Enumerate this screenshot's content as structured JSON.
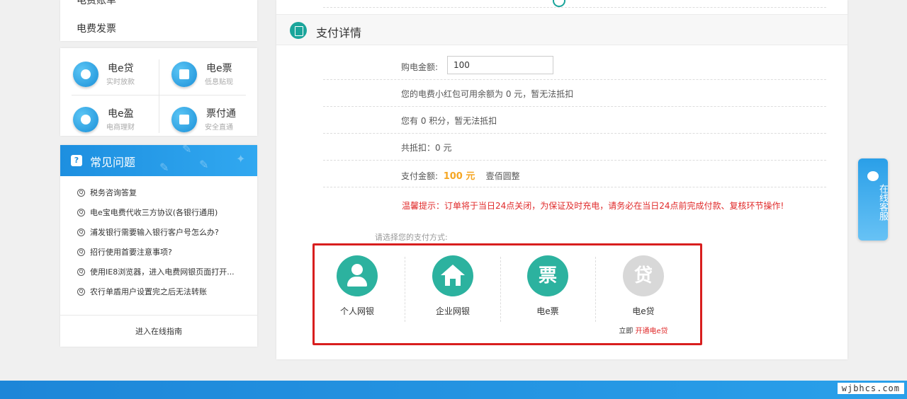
{
  "sidebar": {
    "menu_cut": "电费账单",
    "menu_invoice": "电费发票",
    "services": [
      {
        "name": "电e贷",
        "sub": "实时放款"
      },
      {
        "name": "电e票",
        "sub": "低息贴现"
      },
      {
        "name": "电e盈",
        "sub": "电商理财"
      },
      {
        "name": "票付通",
        "sub": "安全直通"
      }
    ],
    "faq": {
      "title": "常见问题",
      "items": [
        "税务咨询答复",
        "电e宝电费代收三方协议(各银行通用)",
        "浦发银行需要输入银行客户号怎么办?",
        "招行使用首要注意事项?",
        "使用IE8浏览器，进入电费网银页面打开...",
        "农行单盾用户设置完之后无法转账"
      ],
      "footer_link": "进入在线指南"
    }
  },
  "payment": {
    "title": "支付详情",
    "amount_label": "购电金额:",
    "amount_value": "100",
    "redpacket_text": "您的电费小红包可用余额为 0 元，暂无法抵扣",
    "points_text": "您有 0 积分，暂无法抵扣",
    "deduct_text": "共抵扣：0 元",
    "pay_label": "支付金额:",
    "pay_amount": "100 元",
    "pay_words": "壹佰圆整",
    "warning": "温馨提示：订单将于当日24点关闭，为保证及时充电，请务必在当日24点前完成付款、复核环节操作!",
    "choose_label": "请选择您的支付方式:",
    "methods": [
      {
        "label": "个人网银"
      },
      {
        "label": "企业网银"
      },
      {
        "label": "电e票",
        "glyph": "票"
      },
      {
        "label": "电e贷",
        "glyph": "贷",
        "extra_prefix": "立即 ",
        "extra_link": "开通电e贷"
      }
    ]
  },
  "chat_widget": {
    "text": "在线客服"
  },
  "watermark": "wjbhcs.com"
}
